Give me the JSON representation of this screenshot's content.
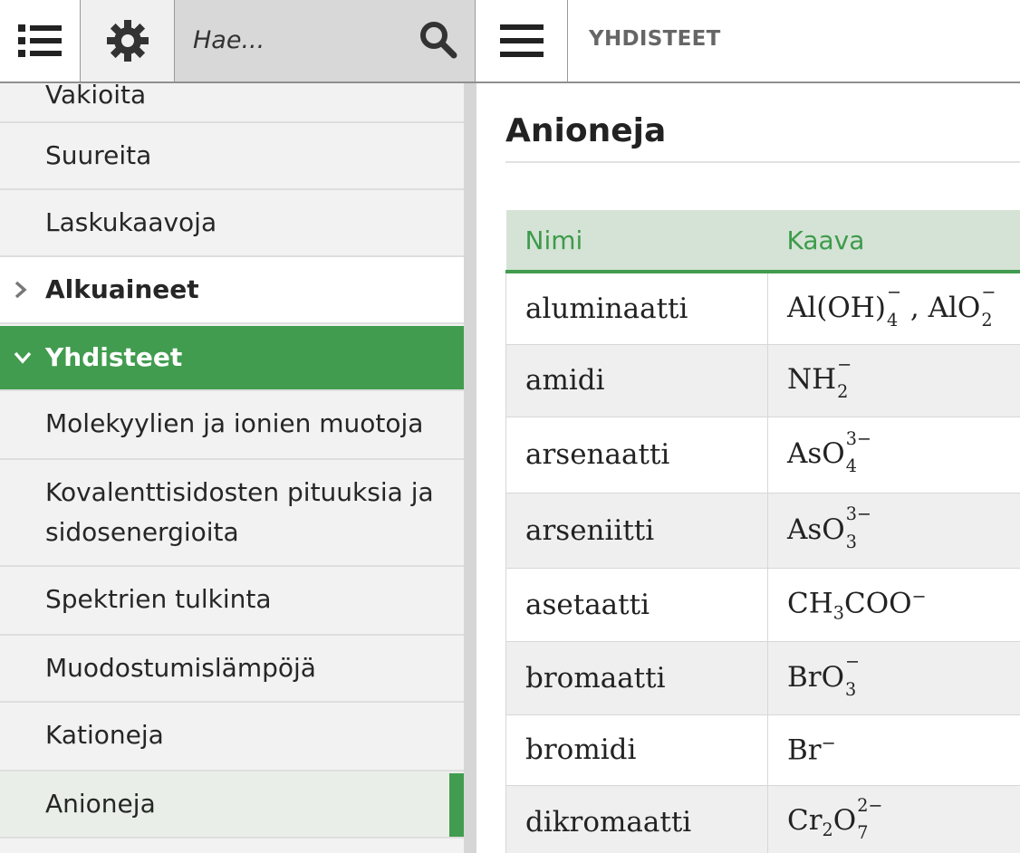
{
  "toolbar": {
    "search_placeholder": "Hae...",
    "title": "YHDISTEET"
  },
  "sidebar": {
    "items": [
      {
        "label": "Vakioita"
      },
      {
        "label": "Suureita"
      },
      {
        "label": "Laskukaavoja"
      },
      {
        "label": "Alkuaineet"
      },
      {
        "label": "Yhdisteet"
      },
      {
        "label": "Molekyylien ja ionien muotoja"
      },
      {
        "label": "Kovalenttisidosten pituuksia ja"
      },
      {
        "label": "sidosenergioita"
      },
      {
        "label": "Spektrien tulkinta"
      },
      {
        "label": "Muodostumislämpöjä"
      },
      {
        "label": "Kationeja"
      },
      {
        "label": "Anioneja"
      }
    ]
  },
  "content": {
    "title": "Anioneja",
    "table": {
      "headers": [
        "Nimi",
        "Kaava"
      ],
      "rows": [
        {
          "name": "aluminaatti",
          "formula": "Al(OH)4⁻ , AlO2⁻"
        },
        {
          "name": "amidi",
          "formula": "NH2⁻"
        },
        {
          "name": "arsenaatti",
          "formula": "AsO4³⁻"
        },
        {
          "name": "arseniitti",
          "formula": "AsO3³⁻"
        },
        {
          "name": "asetaatti",
          "formula": "CH3COO⁻"
        },
        {
          "name": "bromaatti",
          "formula": "BrO3⁻"
        },
        {
          "name": "bromidi",
          "formula": "Br⁻"
        },
        {
          "name": "dikromaatti",
          "formula": "Cr2O7²⁻"
        }
      ]
    }
  },
  "colors": {
    "accent_green": "#419c4f",
    "header_bg": "#d4e3d6"
  },
  "icons": {
    "toc": "list-icon",
    "settings": "gear-icon",
    "search": "search-icon",
    "menu": "hamburger-icon",
    "collapsed": "chevron-right-icon",
    "expanded": "chevron-down-icon"
  }
}
